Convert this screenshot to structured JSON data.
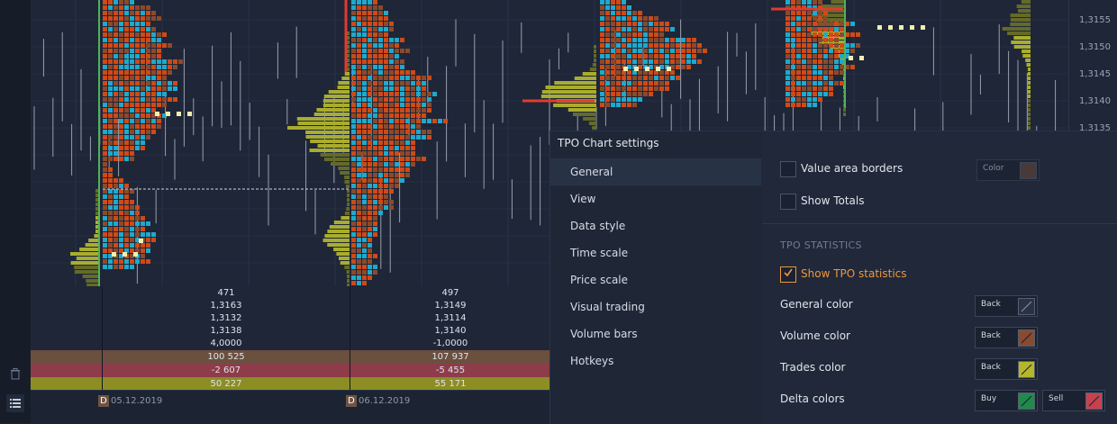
{
  "colors": {
    "profile_olive": "#a9ad2f",
    "profile_olive_dark": "#646a2a",
    "tpo_orange": "#cf4a17",
    "tpo_brown": "#8b4a2c",
    "tpo_cyan": "#1fa9cc",
    "tpo_cream": "#f4efb0",
    "poc_red": "#e03b2f",
    "accent": "#f0963f"
  },
  "price_axis": {
    "ticks": [
      "1,3155",
      "1,3150",
      "1,3145",
      "1,3140",
      "1,3135"
    ]
  },
  "stats": {
    "columns": [
      {
        "values": [
          "471",
          "1,3163",
          "1,3132",
          "1,3138",
          "4,0000"
        ],
        "volume": "100 525",
        "delta": "-2 607",
        "trades": "50 227"
      },
      {
        "values": [
          "497",
          "1,3149",
          "1,3114",
          "1,3140",
          "-1,0000"
        ],
        "volume": "107 937",
        "delta": "-5 455",
        "trades": "55 171"
      }
    ]
  },
  "time_axis": {
    "badge": "D",
    "dates": [
      "05.12.2019",
      "06.12.2019"
    ]
  },
  "icons": {
    "trash": "trash-icon",
    "list": "list-icon"
  },
  "settings": {
    "title": "TPO Chart settings",
    "nav": [
      "General",
      "View",
      "Data style",
      "Time scale",
      "Price scale",
      "Visual trading",
      "Volume bars",
      "Hotkeys"
    ],
    "active_nav": "General",
    "value_area_borders": "Value area borders",
    "value_area_color_label": "Color",
    "show_totals": "Show Totals",
    "section_stats": "TPO STATISTICS",
    "show_tpo_stats": "Show TPO statistics",
    "general_color": "General color",
    "volume_color": "Volume color",
    "trades_color": "Trades color",
    "delta_colors": "Delta colors",
    "back_label": "Back",
    "buy_label": "Buy",
    "sell_label": "Sell",
    "swatches": {
      "value_area": "#6b4a3c",
      "general": "#2a3245",
      "volume": "#8a4a30",
      "trades": "#b6b62c",
      "buy": "#1f8a4a",
      "sell": "#c8414e"
    }
  }
}
